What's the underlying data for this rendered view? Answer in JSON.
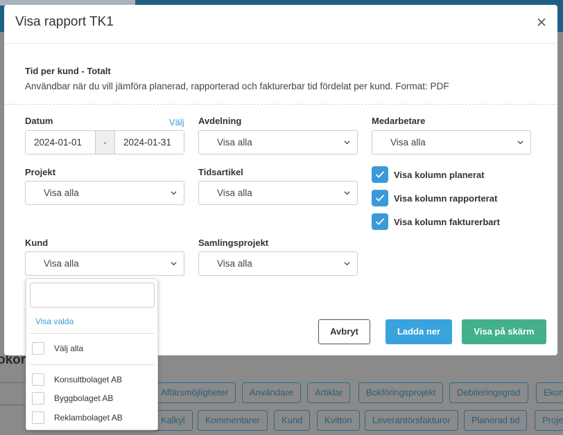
{
  "background": {
    "heading": "okord",
    "tags_row1": [
      "Affärsmöjligheter",
      "Användare",
      "Artiklar",
      "Bokföringsprojekt",
      "Debiteringsgrad",
      "Ekon"
    ],
    "tags_row2": [
      "Kalkyl",
      "Kommentarer",
      "Kund",
      "Kvitton",
      "Leverantörsfakturor",
      "Planerad tid",
      "Proje"
    ]
  },
  "modal": {
    "title": "Visa rapport TK1",
    "close_icon": "close-icon",
    "report_name": "Tid per kund - Totalt",
    "report_description": "Användbar när du vill jämföra planerad, rapporterad och fakturerbar tid fördelat per kund. Format: PDF"
  },
  "filters": {
    "datum": {
      "label": "Datum",
      "link": "Välj",
      "from": "2024-01-01",
      "separator": "-",
      "to": "2024-01-31"
    },
    "avdelning": {
      "label": "Avdelning",
      "value": "Visa alla"
    },
    "medarbetare": {
      "label": "Medarbetare",
      "value": "Visa alla"
    },
    "projekt": {
      "label": "Projekt",
      "value": "Visa alla"
    },
    "tidsartikel": {
      "label": "Tidsartikel",
      "value": "Visa alla"
    },
    "kund": {
      "label": "Kund",
      "value": "Visa alla"
    },
    "samlingsprojekt": {
      "label": "Samlingsprojekt",
      "value": "Visa alla"
    }
  },
  "checkboxes": [
    {
      "label": "Visa kolumn planerat",
      "checked": true
    },
    {
      "label": "Visa kolumn rapporterat",
      "checked": true
    },
    {
      "label": "Visa kolumn fakturerbart",
      "checked": true
    }
  ],
  "buttons": {
    "cancel": "Avbryt",
    "download": "Ladda ner",
    "show_on_screen": "Visa på skärm"
  },
  "dropdown": {
    "search_value": "",
    "show_selected": "Visa valda",
    "select_all": "Välj alla",
    "options": [
      "Konsultbolaget AB",
      "Byggbolaget AB",
      "Reklambolaget AB"
    ]
  },
  "colors": {
    "accent_blue": "#3aa3de",
    "green": "#43b08a",
    "checkbox_blue": "#3a9ad9"
  }
}
